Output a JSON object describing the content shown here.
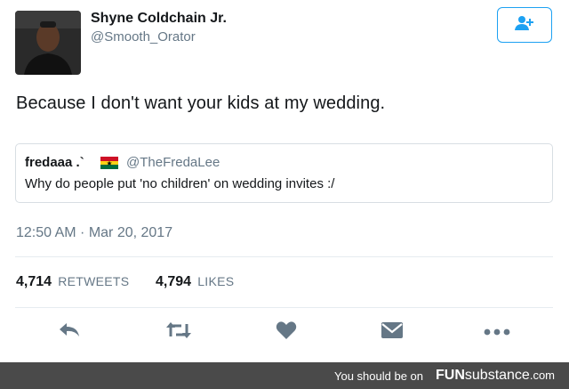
{
  "author": {
    "display_name": "Shyne Coldchain Jr.",
    "handle": "@Smooth_Orator"
  },
  "follow_button": {
    "icon": "add-user-icon",
    "color": "#1da1f2"
  },
  "tweet": {
    "text": "Because I don't want your kids at my wedding.",
    "timestamp": "12:50 AM · Mar 20, 2017"
  },
  "quoted_tweet": {
    "display_name": "fredaaa .`",
    "flag": "ghana-flag",
    "handle": "@TheFredaLee",
    "text": "Why do people put 'no children' on wedding invites :/"
  },
  "stats": {
    "retweets_count": "4,714",
    "retweets_label": "RETWEETS",
    "likes_count": "4,794",
    "likes_label": "LIKES"
  },
  "actions": [
    {
      "name": "reply-icon"
    },
    {
      "name": "retweet-icon"
    },
    {
      "name": "heart-icon"
    },
    {
      "name": "direct-message-icon"
    },
    {
      "name": "more-icon"
    }
  ],
  "watermark": {
    "prefix": "You should be on",
    "brand_bold": "FUN",
    "brand_rest": "substance",
    "brand_suffix": ".com"
  },
  "colors": {
    "text": "#14171a",
    "muted": "#657786",
    "action_icon": "#657786",
    "accent": "#1da1f2",
    "footer_bg": "#4a4a4a"
  }
}
